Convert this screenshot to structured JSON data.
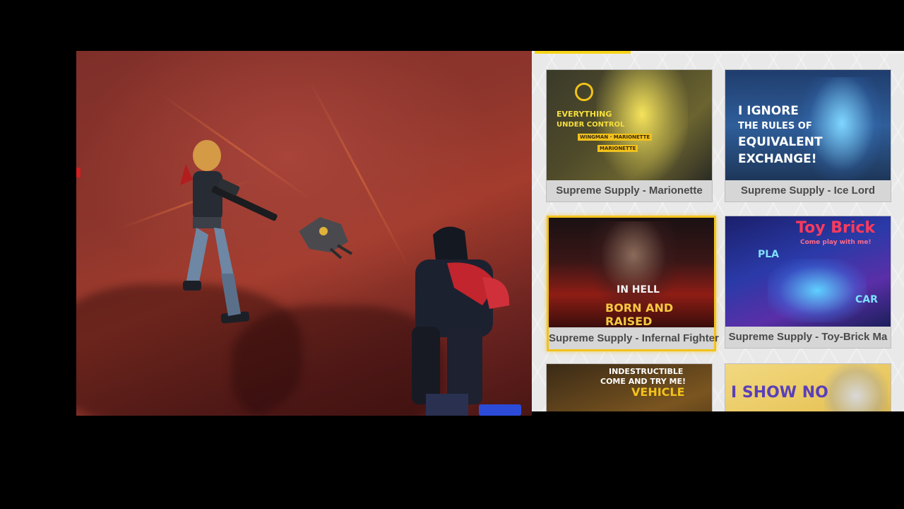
{
  "shop": {
    "cards": [
      {
        "label": "Supreme Supply - Marionette",
        "art_lines": [
          "EVERYTHING",
          "UNDER CONTROL",
          "WINGMAN · MARIONETTE",
          "MARIONETTE"
        ],
        "selected": false
      },
      {
        "label": "Supreme Supply - Ice Lord",
        "art_lines": [
          "I IGNORE",
          "THE RULES OF",
          "EQUIVALENT",
          "EXCHANGE!"
        ],
        "selected": false
      },
      {
        "label": "Supreme Supply - Infernal Fighter",
        "art_lines": [
          "IN HELL",
          "BORN AND RAISED"
        ],
        "selected": true
      },
      {
        "label": "Supreme Supply - Toy-Brick Ma",
        "art_lines": [
          "Toy Brick",
          "Come play with me!",
          "PLA",
          "CAR"
        ],
        "selected": false
      },
      {
        "label": "",
        "art_lines": [
          "INDESTRUCTIBLE",
          "COME AND TRY ME!",
          "VEHICLE"
        ],
        "selected": false
      },
      {
        "label": "",
        "art_lines": [
          "I SHOW NO"
        ],
        "selected": false
      }
    ]
  },
  "colors": {
    "selected_border": "#f2c21b",
    "card_label_text": "#4a4a4a",
    "game_bg": "#8d352c"
  }
}
